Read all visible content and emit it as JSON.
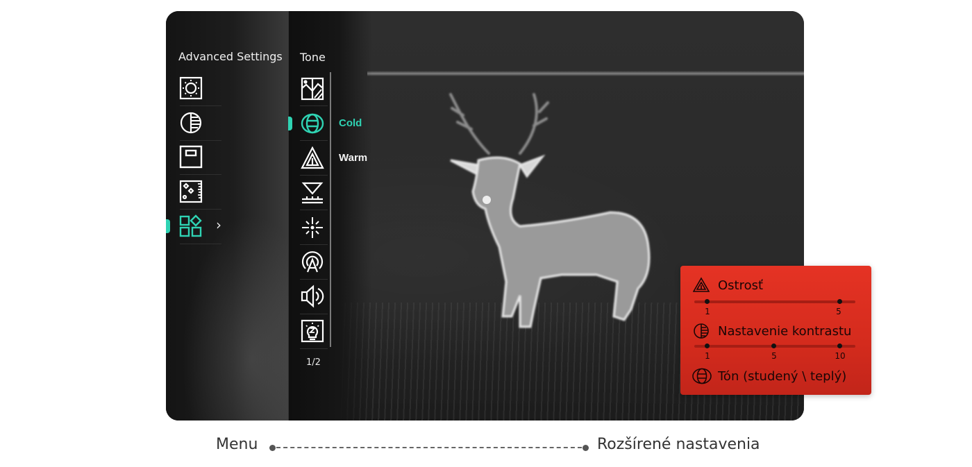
{
  "device_screen": {
    "advanced_settings_title": "Advanced Settings",
    "sidebar_items": [
      {
        "icon": "brightness-icon"
      },
      {
        "icon": "contrast-icon"
      },
      {
        "icon": "frame-icon"
      },
      {
        "icon": "image-enhance-icon"
      },
      {
        "icon": "apps-grid-icon",
        "active": true
      }
    ],
    "tone_title": "Tone",
    "tone_items": [
      {
        "icon": "landscape-icon"
      },
      {
        "icon": "tone-icon",
        "active": true
      },
      {
        "icon": "sharpness-icon"
      },
      {
        "icon": "calibration-icon"
      },
      {
        "icon": "crosshair-icon"
      },
      {
        "icon": "hotspot-icon"
      },
      {
        "icon": "speaker-icon"
      },
      {
        "icon": "sleep-light-icon"
      }
    ],
    "options": [
      {
        "label": "Cold",
        "selected": true
      },
      {
        "label": "Warm",
        "selected": false
      }
    ],
    "page_indicator": "1/2",
    "accent_color": "#2fd3b3"
  },
  "callout": {
    "background_color": "#e0301f",
    "items": [
      {
        "icon": "sharpness-icon",
        "label": "Ostrosť",
        "scale": [
          "1",
          "5"
        ]
      },
      {
        "icon": "contrast-icon",
        "label": "Nastavenie kontrastu",
        "scale": [
          "1",
          "5",
          "10"
        ]
      },
      {
        "icon": "tone-icon",
        "label": "Tón (studený \\ teplý)"
      }
    ]
  },
  "captions": {
    "left": "Menu",
    "right": "Rozšírené nastavenia"
  }
}
